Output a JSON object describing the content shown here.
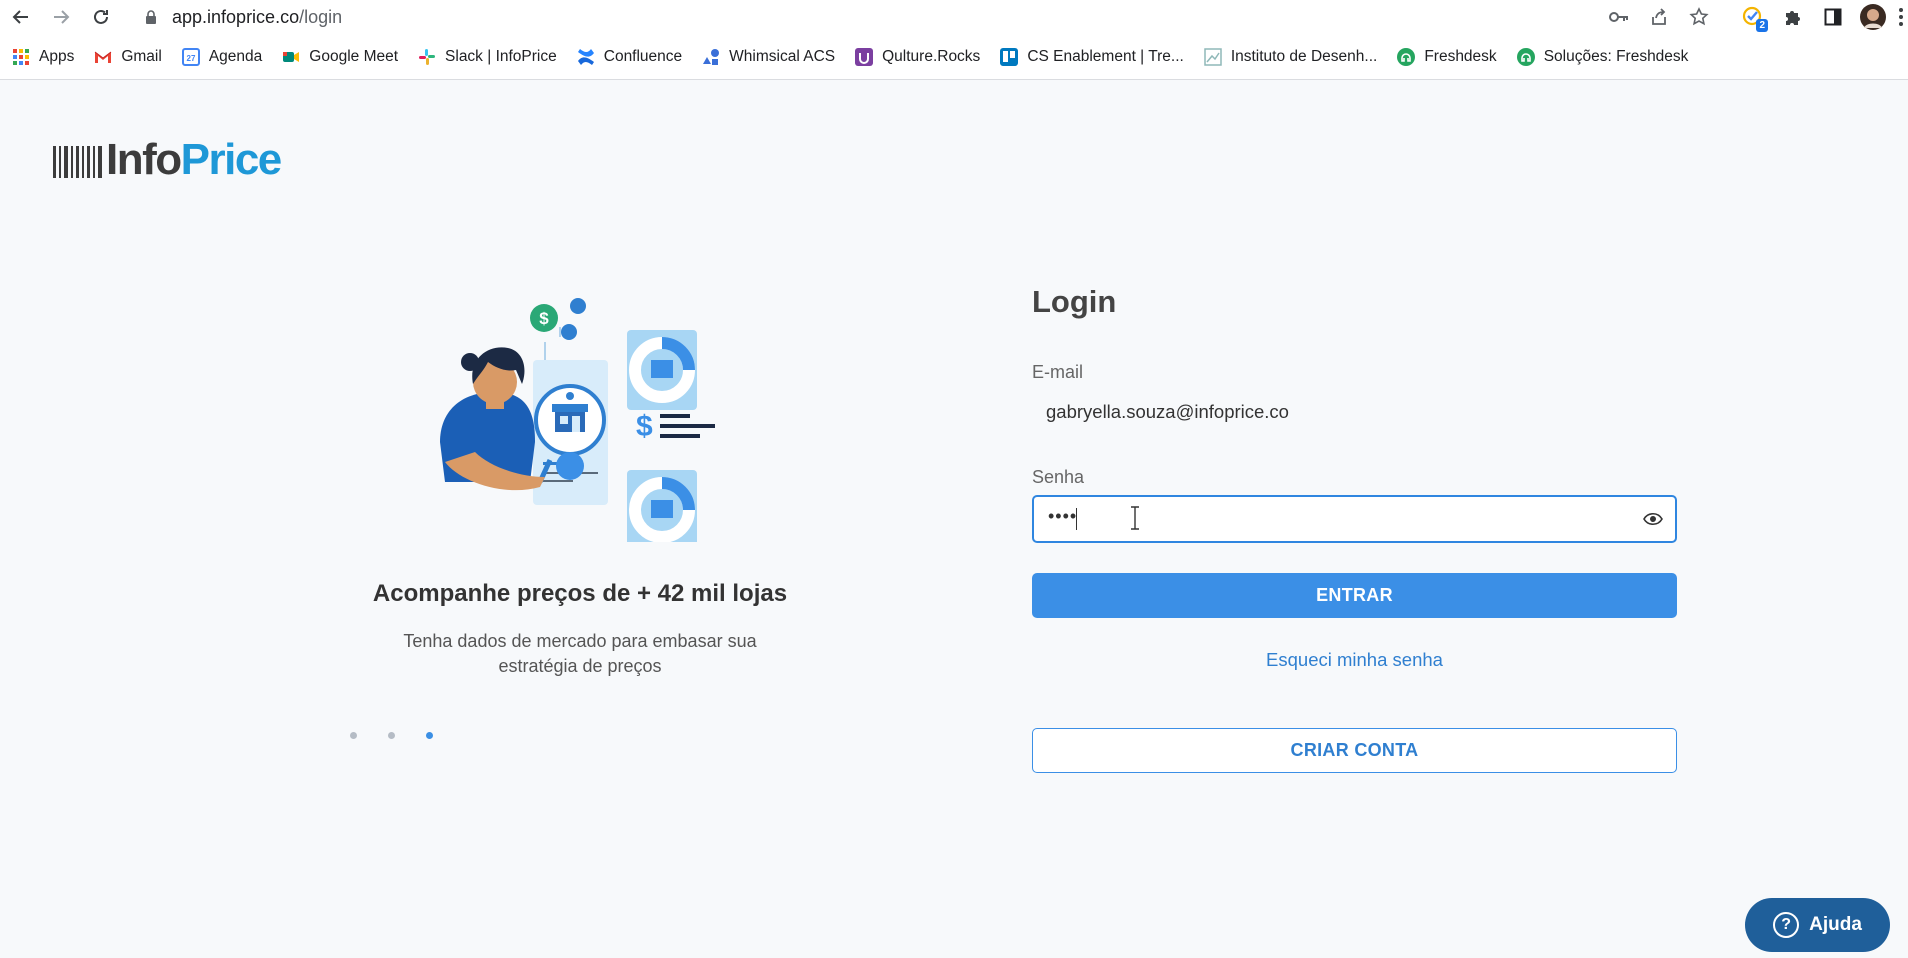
{
  "browser": {
    "url_host": "app.infoprice.co",
    "url_path": "/login",
    "extension_badge": "2",
    "bookmarks": [
      {
        "label": "Apps",
        "icon": "apps-grid-icon",
        "color": "#ea4335"
      },
      {
        "label": "Gmail",
        "icon": "gmail-icon",
        "color": "#ea4335"
      },
      {
        "label": "Agenda",
        "icon": "calendar-icon",
        "color": "#4285f4"
      },
      {
        "label": "Google Meet",
        "icon": "meet-icon",
        "color": "#00897b"
      },
      {
        "label": "Slack | InfoPrice",
        "icon": "slack-icon",
        "color": "#e01e5a"
      },
      {
        "label": "Confluence",
        "icon": "confluence-icon",
        "color": "#1868db"
      },
      {
        "label": "Whimsical ACS",
        "icon": "whimsical-icon",
        "color": "#3a6fd8"
      },
      {
        "label": "Qulture.Rocks",
        "icon": "qulture-icon",
        "color": "#7b3fa0"
      },
      {
        "label": "CS Enablement | Tre...",
        "icon": "trello-icon",
        "color": "#0079bf"
      },
      {
        "label": "Instituto de Desenh...",
        "icon": "instituto-icon",
        "color": "#8fb8b8"
      },
      {
        "label": "Freshdesk",
        "icon": "freshdesk-icon",
        "color": "#25a55f"
      },
      {
        "label": "Soluções: Freshdesk",
        "icon": "freshdesk-icon",
        "color": "#25a55f"
      }
    ]
  },
  "logo": {
    "part1": "Info",
    "part2": "Price",
    "color_dark": "#3c3c3c",
    "color_blue": "#1e98d7"
  },
  "hero": {
    "title": "Acompanhe preços de + 42 mil lojas",
    "subtitle_line1": "Tenha dados de mercado para embasar sua",
    "subtitle_line2": "estratégia de preços",
    "active_slide": 3,
    "slide_count": 3
  },
  "login": {
    "title": "Login",
    "email_label": "E-mail",
    "email_value": "gabryella.souza@infoprice.co",
    "password_label": "Senha",
    "password_masked": "••••",
    "enter_button": "ENTRAR",
    "forgot_link": "Esqueci minha senha",
    "create_button": "CRIAR CONTA",
    "accent": "#3b8fe6"
  },
  "help": {
    "label": "Ajuda",
    "color": "#1f5f9a"
  }
}
